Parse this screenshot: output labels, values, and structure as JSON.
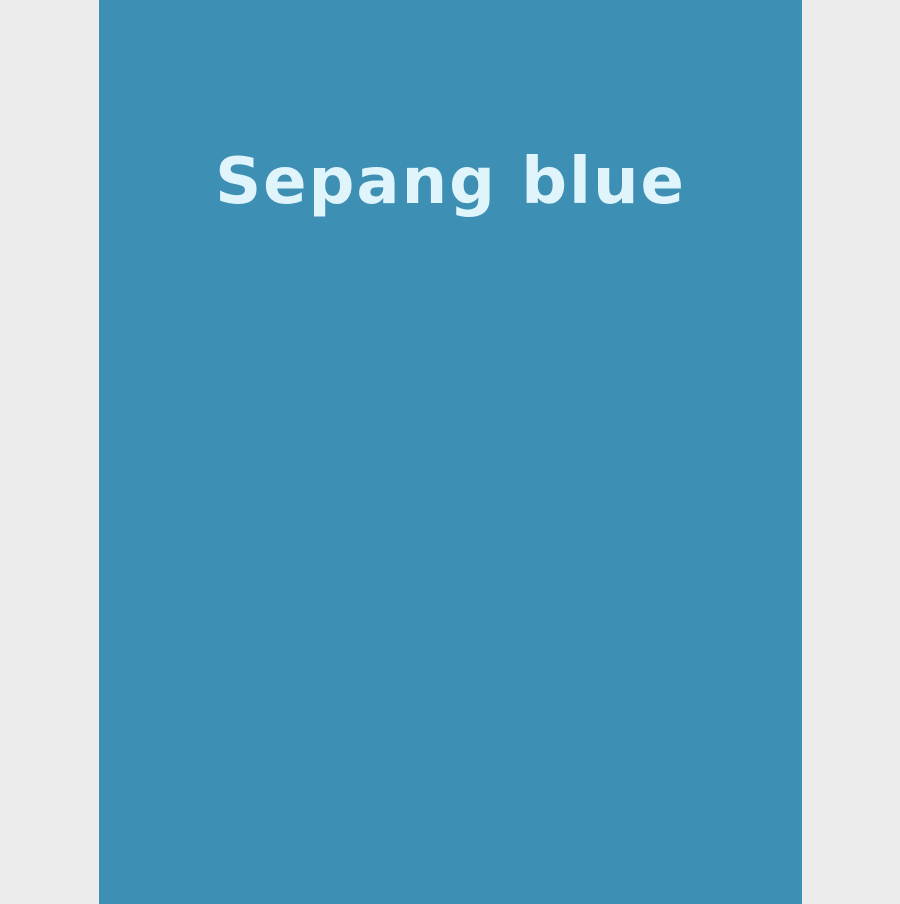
{
  "swatch": {
    "name": "Sepang blue",
    "color": "#3d8fb4",
    "text_color": "#dff4fb"
  },
  "page": {
    "background": "#ececec"
  }
}
